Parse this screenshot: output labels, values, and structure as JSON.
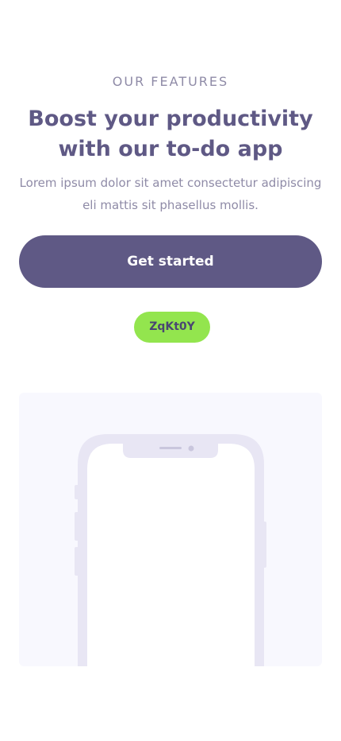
{
  "features": {
    "eyebrow": "OUR FEATURES",
    "headline_line1": "Boost your productivity",
    "headline_line2": "with our to-do app",
    "lead_line1": "Lorem ipsum dolor sit amet consectetur adipiscing",
    "lead_line2": "eli mattis sit phasellus mollis.",
    "cta_label": "Get started",
    "tag": "ZqKt0Y"
  },
  "colors": {
    "primary": "#5f5985",
    "muted_text": "#8f8ba7",
    "tag_green": "#93e54e",
    "panel_background": "#f8f8fe",
    "phone_frame": "#e8e6f4"
  },
  "icons": {
    "mockup": "smartphone-outline"
  }
}
